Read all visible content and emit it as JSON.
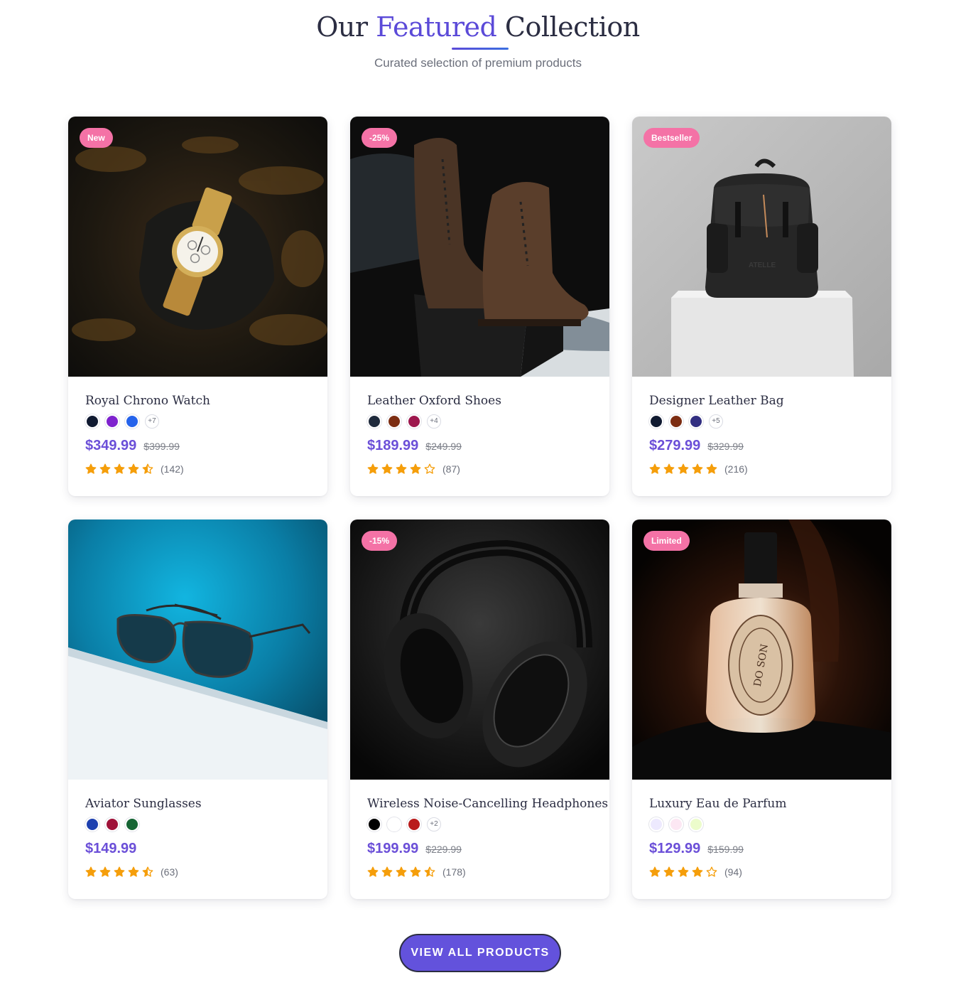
{
  "header": {
    "title_pre": "Our",
    "title_accent": "Featured",
    "title_post": "Collection",
    "subtitle": "Curated selection of premium products"
  },
  "products": [
    {
      "name": "Royal Chrono Watch",
      "badge": "New",
      "swatches": [
        "#0f1930",
        "#7e22ce",
        "#2563eb"
      ],
      "more": "+7",
      "price": "$349.99",
      "old_price": "$399.99",
      "rating": 4.5,
      "reviews": "(142)"
    },
    {
      "name": "Leather Oxford Shoes",
      "badge": "-25%",
      "swatches": [
        "#1e293b",
        "#7c2d12",
        "#9d174d"
      ],
      "more": "+4",
      "price": "$189.99",
      "old_price": "$249.99",
      "rating": 4,
      "reviews": "(87)"
    },
    {
      "name": "Designer Leather Bag",
      "badge": "Bestseller",
      "swatches": [
        "#0f1930",
        "#7c2d12",
        "#312e81"
      ],
      "more": "+5",
      "price": "$279.99",
      "old_price": "$329.99",
      "rating": 5,
      "reviews": "(216)"
    },
    {
      "name": "Aviator Sunglasses",
      "badge": "",
      "swatches": [
        "#1e40af",
        "#9f1239",
        "#166534"
      ],
      "more": "",
      "price": "$149.99",
      "old_price": "",
      "rating": 4.5,
      "reviews": "(63)"
    },
    {
      "name": "Wireless Noise-Cancelling Headphones",
      "badge": "-15%",
      "swatches": [
        "#000000",
        "#ffffff",
        "#b91c1c"
      ],
      "more": "+2",
      "price": "$199.99",
      "old_price": "$229.99",
      "rating": 4.5,
      "reviews": "(178)"
    },
    {
      "name": "Luxury Eau de Parfum",
      "badge": "Limited",
      "swatches": [
        "#ede9fe",
        "#fce7f3",
        "#ecfccb"
      ],
      "more": "",
      "price": "$129.99",
      "old_price": "$159.99",
      "rating": 4,
      "reviews": "(94)"
    }
  ],
  "cta": {
    "label": "VIEW ALL PRODUCTS"
  },
  "colors": {
    "accent": "#6352dc",
    "badge": "#f472a6",
    "star": "#f59e0b",
    "price": "#6b4fd8"
  },
  "icons": {
    "star_full": "star-icon",
    "star_half": "star-half-icon",
    "star_empty": "star-outline-icon"
  }
}
